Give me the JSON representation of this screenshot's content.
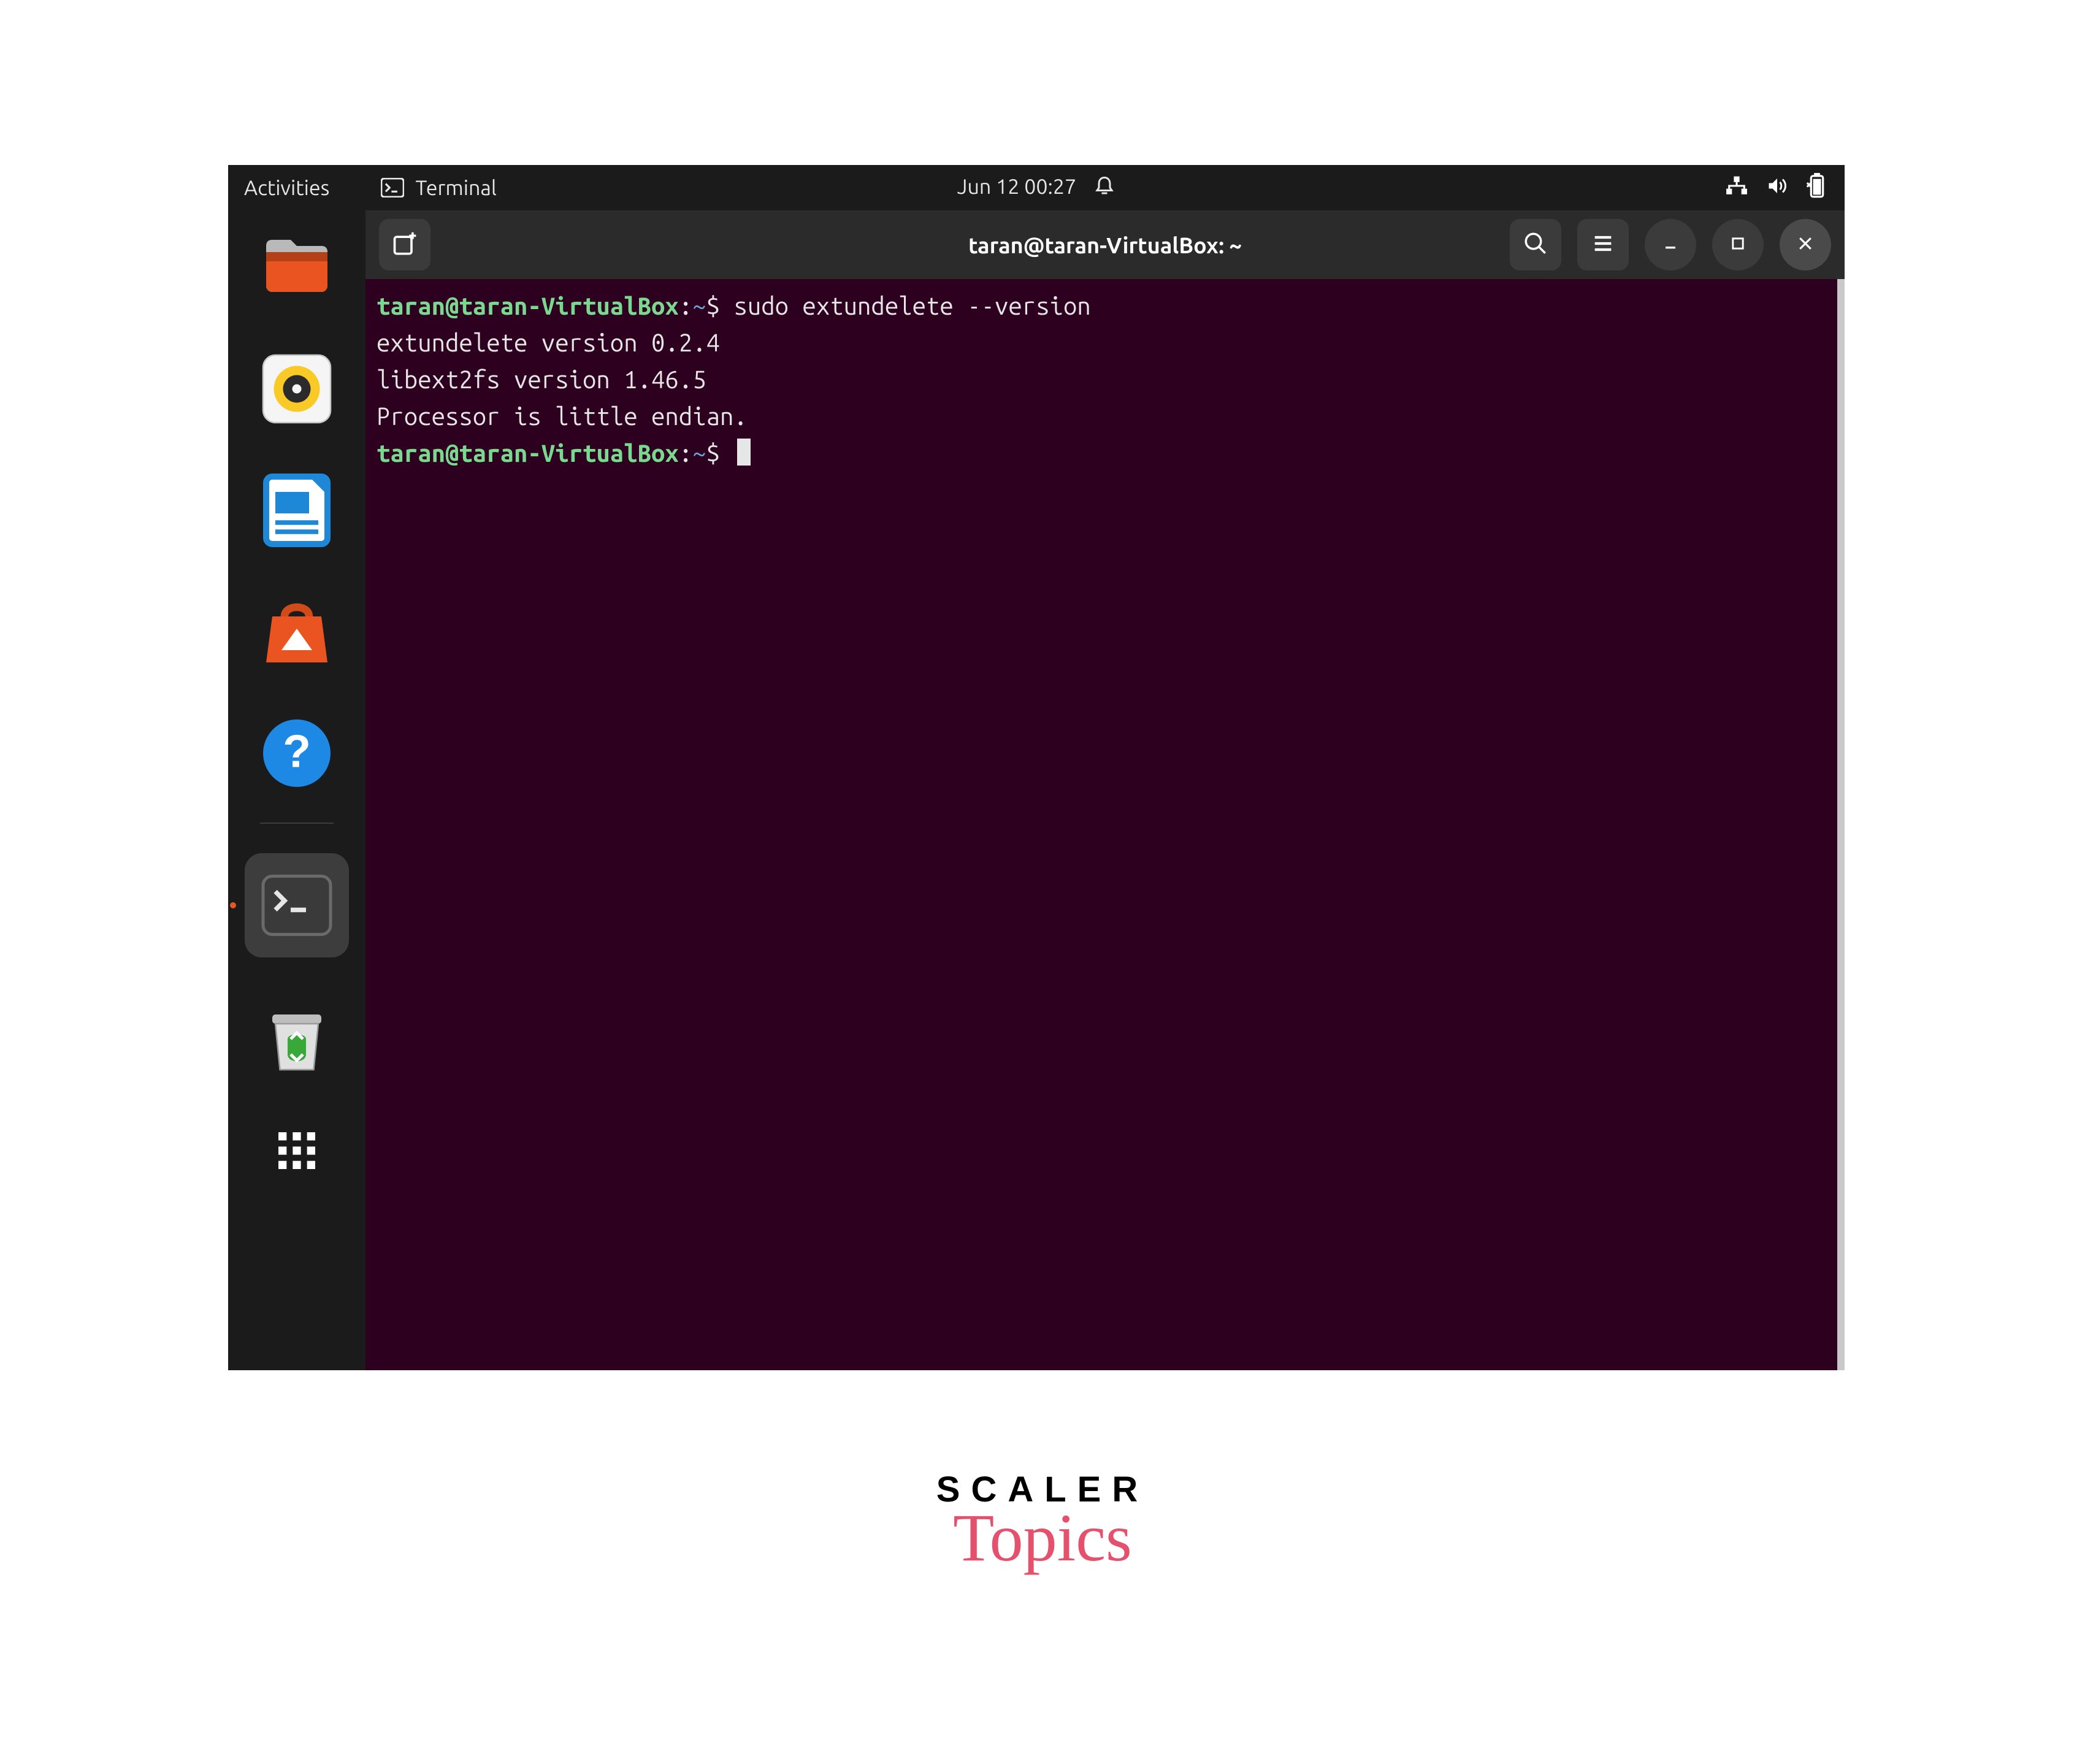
{
  "topbar": {
    "activities_label": "Activities",
    "app_label": "Terminal",
    "clock": "Jun 12  00:27"
  },
  "dock": {
    "items": [
      {
        "name": "files"
      },
      {
        "name": "rhythmbox"
      },
      {
        "name": "writer"
      },
      {
        "name": "software"
      },
      {
        "name": "help"
      },
      {
        "name": "terminal"
      },
      {
        "name": "trash"
      }
    ]
  },
  "terminal": {
    "title": "taran@taran-VirtualBox: ~",
    "prompt_user": "taran@taran-VirtualBox",
    "prompt_path": "~",
    "lines": [
      {
        "type": "cmd",
        "command": "sudo extundelete --version"
      },
      {
        "type": "out",
        "text": "extundelete version 0.2.4"
      },
      {
        "type": "out",
        "text": "libext2fs version 1.46.5"
      },
      {
        "type": "out",
        "text": "Processor is little endian."
      },
      {
        "type": "cmd",
        "command": ""
      }
    ]
  },
  "watermark": {
    "line1": "SCALER",
    "line2": "Topics"
  }
}
